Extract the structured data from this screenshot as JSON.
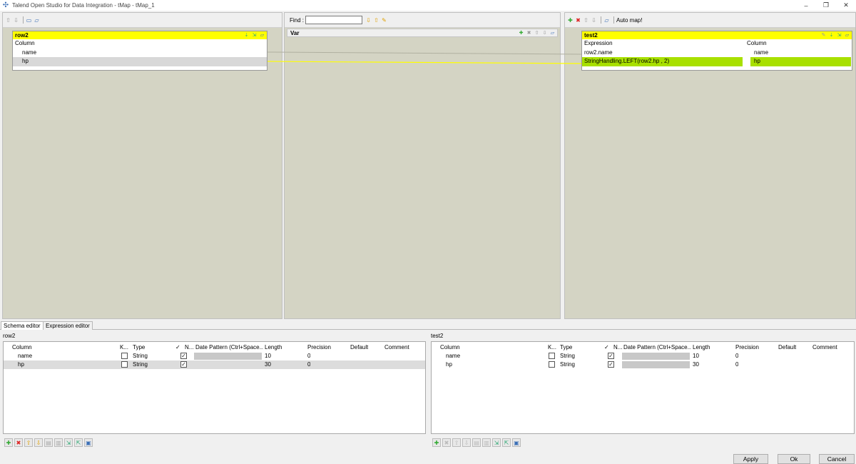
{
  "window": {
    "title": "Talend Open Studio for Data Integration - tMap - tMap_1",
    "minimize": "–",
    "restore": "❐",
    "close": "✕"
  },
  "input_panel": {
    "table_name": "row2",
    "column_header": "Column",
    "rows": [
      "name",
      "hp"
    ]
  },
  "var_panel": {
    "find_label": "Find :",
    "find_value": "",
    "table_name": "Var"
  },
  "output_panel": {
    "auto_map_label": "Auto map!",
    "table_name": "test2",
    "expression_header": "Expression",
    "column_header": "Column",
    "rows": [
      {
        "expression": "row2.name",
        "column": "name"
      },
      {
        "expression": "StringHandling.LEFT(row2.hp , 2)",
        "column": "hp"
      }
    ]
  },
  "tabs": [
    "Schema editor",
    "Expression editor"
  ],
  "schema_left": {
    "title": "row2",
    "headers": [
      "Column",
      "K...",
      "Type",
      "✓",
      "N...",
      "Date Pattern (Ctrl+Space...",
      "Length",
      "Precision",
      "Default",
      "Comment"
    ],
    "rows": [
      {
        "column": "name",
        "key": false,
        "type": "String",
        "nullable": true,
        "length": "10",
        "precision": "0"
      },
      {
        "column": "hp",
        "key": false,
        "type": "String",
        "nullable": true,
        "length": "30",
        "precision": "0"
      }
    ]
  },
  "schema_right": {
    "title": "test2",
    "headers": [
      "Column",
      "K...",
      "Type",
      "✓",
      "N...",
      "Date Pattern (Ctrl+Space...",
      "Length",
      "Precision",
      "Default",
      "Comment"
    ],
    "rows": [
      {
        "column": "name",
        "key": false,
        "type": "String",
        "nullable": true,
        "length": "10",
        "precision": "0"
      },
      {
        "column": "hp",
        "key": false,
        "type": "String",
        "nullable": true,
        "length": "30",
        "precision": "0"
      }
    ]
  },
  "buttons": {
    "apply": "Apply",
    "ok": "Ok",
    "cancel": "Cancel"
  },
  "colors": {
    "header_yellow": "#ffff00",
    "mapped_green": "#a8e000",
    "panel_bg": "#d4d4c4"
  }
}
